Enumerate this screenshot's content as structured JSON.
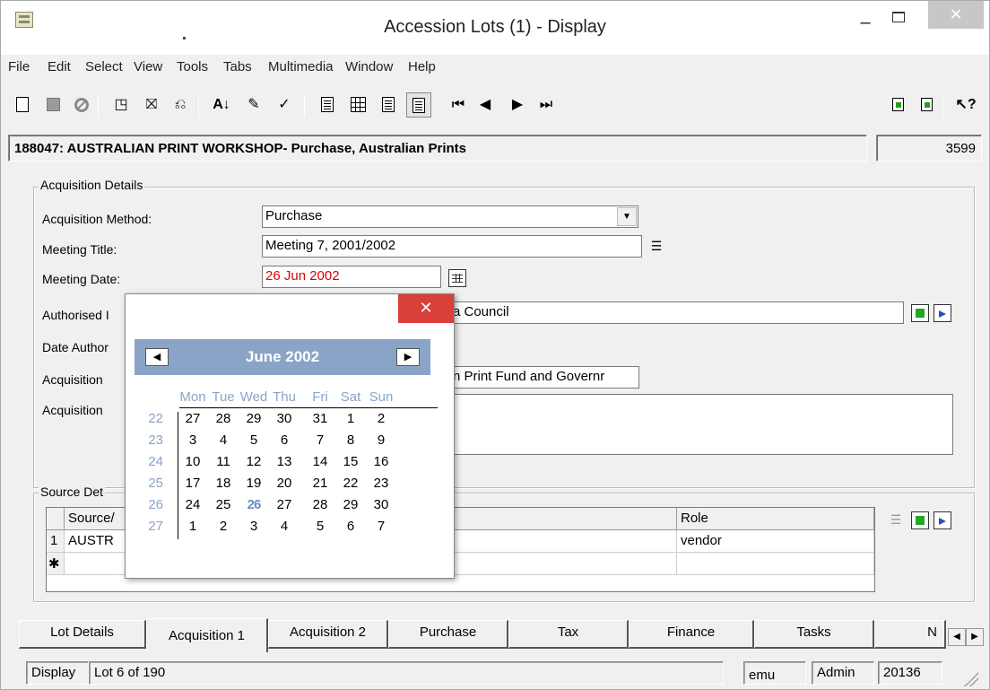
{
  "window": {
    "title": "Accession Lots (1) - Display",
    "minimize": "–",
    "close": "✕"
  },
  "menu": [
    "File",
    "Edit",
    "Select",
    "View",
    "Tools",
    "Tabs",
    "Multimedia",
    "Window",
    "Help"
  ],
  "toolbar": {
    "icons": [
      "new-document-icon",
      "save-icon",
      "cancel-icon",
      "select-record-icon",
      "delete-record-icon",
      "undo-record-icon",
      "sort-icon",
      "edit-icon",
      "spell-check-icon",
      "details-view-icon",
      "list-view-icon",
      "page-view-icon",
      "image-view-icon",
      "first-record-icon",
      "previous-record-icon",
      "next-record-icon",
      "last-record-icon",
      "attach-icon",
      "copy-icon",
      "help-icon"
    ]
  },
  "record": {
    "summary": "188047: AUSTRALIAN PRINT WORKSHOP- Purchase, Australian Prints",
    "id": "3599"
  },
  "acquisition": {
    "group_label": "Acquisition Details",
    "method_label": "Acquisition Method:",
    "method_value": "Purchase",
    "meeting_title_label": "Meeting Title:",
    "meeting_title_value": "Meeting 7, 2001/2002",
    "meeting_date_label": "Meeting Date:",
    "meeting_date_value": "26 Jun 2002",
    "authorised_label": "Authorised I",
    "authorised_value": "a Council",
    "date_auth_label": "Date Author",
    "acq_funds_label": "Acquisition",
    "acq_funds_value": "n Print Fund and Governr",
    "acq_notes_label": "Acquisition"
  },
  "source": {
    "group_label": "Source Det",
    "columns": [
      "Source/",
      "Role"
    ],
    "rows": [
      {
        "num": "1",
        "source": "AUSTR",
        "role": "vendor"
      }
    ],
    "new_row_marker": "✱"
  },
  "calendar": {
    "close": "✕",
    "month_title": "June 2002",
    "prev": "◀",
    "next": "▶",
    "days_of_week": [
      "Mon",
      "Tue",
      "Wed",
      "Thu",
      "Fri",
      "Sat",
      "Sun"
    ],
    "week_numbers": [
      "22",
      "23",
      "24",
      "25",
      "26",
      "27"
    ],
    "weeks": [
      [
        "27",
        "28",
        "29",
        "30",
        "31",
        "1",
        "2"
      ],
      [
        "3",
        "4",
        "5",
        "6",
        "7",
        "8",
        "9"
      ],
      [
        "10",
        "11",
        "12",
        "13",
        "14",
        "15",
        "16"
      ],
      [
        "17",
        "18",
        "19",
        "20",
        "21",
        "22",
        "23"
      ],
      [
        "24",
        "25",
        "26",
        "27",
        "28",
        "29",
        "30"
      ],
      [
        "1",
        "2",
        "3",
        "4",
        "5",
        "6",
        "7"
      ]
    ],
    "selected_day": "26",
    "header_color": "#8aa4c8"
  },
  "tabs": [
    "Lot Details",
    "Acquisition 1",
    "Acquisition 2",
    "Purchase",
    "Tax",
    "Finance",
    "Tasks",
    "N"
  ],
  "active_tab": "Acquisition 1",
  "status": {
    "mode": "Display",
    "position": "Lot 6 of 190",
    "user": "emu",
    "role": "Admin",
    "number": "20136"
  },
  "colors": {
    "close_active": "#d9403a",
    "meeting_date_text": "#e00000"
  }
}
